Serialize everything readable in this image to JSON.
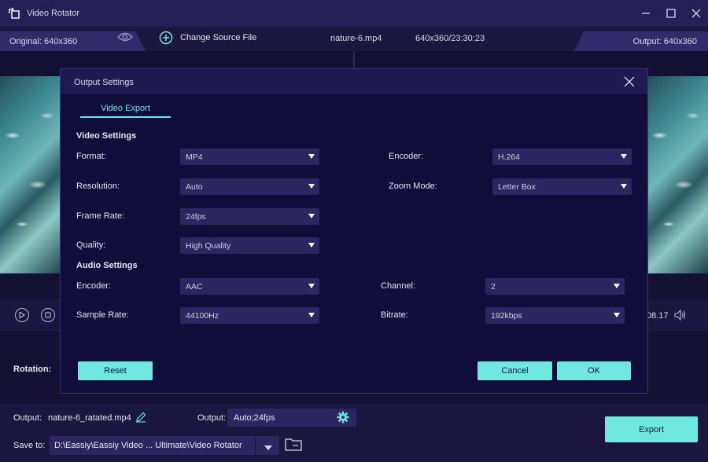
{
  "app": {
    "title": "Video Rotator"
  },
  "infobar": {
    "original_label": "Original: 640x360",
    "change_source": "Change Source File",
    "file_name": "nature-6.mp4",
    "file_meta": "640x360/23:30:23",
    "output_label": "Output: 640x360"
  },
  "player": {
    "time": "08.17"
  },
  "rotation": {
    "label": "Rotation:"
  },
  "bottom": {
    "output_label": "Output:",
    "output_file": "nature-6_ratated.mp4",
    "output_label2": "Output:",
    "output_setting": "Auto;24fps",
    "save_label": "Save to:",
    "save_path": "D:\\Eassiy\\Eassiy Video ... Ultimate\\Video Rotator",
    "export_label": "Export"
  },
  "dialog": {
    "title": "Output Settings",
    "tab": "Video Export",
    "video_section": "Video Settings",
    "audio_section": "Audio Settings",
    "video": {
      "format_label": "Format:",
      "format_value": "MP4",
      "resolution_label": "Resolution:",
      "resolution_value": "Auto",
      "framerate_label": "Frame Rate:",
      "framerate_value": "24fps",
      "quality_label": "Quality:",
      "quality_value": "High Quality",
      "encoder_label": "Encoder:",
      "encoder_value": "H.264",
      "zoom_label": "Zoom Mode:",
      "zoom_value": "Letter Box"
    },
    "audio": {
      "encoder_label": "Encoder:",
      "encoder_value": "AAC",
      "samplerate_label": "Sample Rate:",
      "samplerate_value": "44100Hz",
      "channel_label": "Channel:",
      "channel_value": "2",
      "bitrate_label": "Bitrate:",
      "bitrate_value": "192kbps"
    },
    "buttons": {
      "reset": "Reset",
      "cancel": "Cancel",
      "ok": "OK"
    }
  },
  "colors": {
    "accent": "#6fe8e0",
    "background": "#1a1640",
    "dialog": "#110d3a",
    "field": "#2b2560"
  }
}
